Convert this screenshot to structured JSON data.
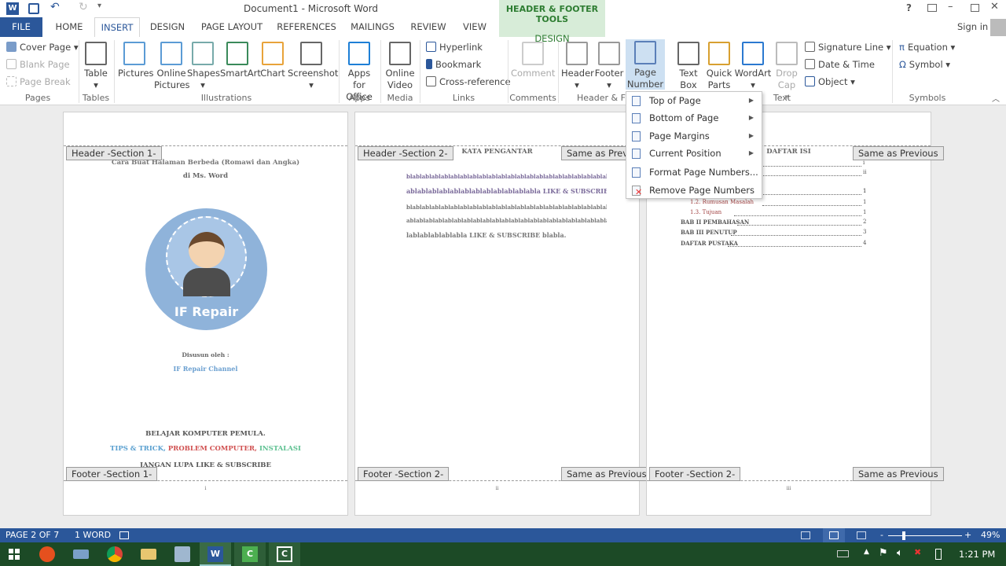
{
  "title": "Document1 - Microsoft Word",
  "contextual": {
    "group": "HEADER & FOOTER TOOLS",
    "tab": "DESIGN",
    "color": "#d7ecd8"
  },
  "window_controls": {
    "help": "?",
    "sign_in": "Sign in"
  },
  "tabs": [
    "FILE",
    "HOME",
    "INSERT",
    "DESIGN",
    "PAGE LAYOUT",
    "REFERENCES",
    "MAILINGS",
    "REVIEW",
    "VIEW"
  ],
  "active_tab": "INSERT",
  "ribbon": {
    "pages": {
      "items": [
        "Cover Page",
        "Blank Page",
        "Page Break"
      ],
      "label": "Pages"
    },
    "tables": {
      "items": [
        "Table"
      ],
      "label": "Tables"
    },
    "illustrations": {
      "items": [
        "Pictures",
        "Online Pictures",
        "Shapes",
        "SmartArt",
        "Chart",
        "Screenshot"
      ],
      "label": "Illustrations"
    },
    "apps": {
      "items": [
        "Apps for Office"
      ],
      "label": "Apps"
    },
    "media": {
      "items": [
        "Online Video"
      ],
      "label": "Media"
    },
    "links": {
      "items": [
        "Hyperlink",
        "Bookmark",
        "Cross-reference"
      ],
      "label": "Links"
    },
    "comments": {
      "items": [
        "Comment"
      ],
      "label": "Comments"
    },
    "headerfooter": {
      "items": [
        "Header",
        "Footer",
        "Page Number"
      ],
      "label": "Header & F"
    },
    "text": {
      "items": [
        "Text Box",
        "Quick Parts",
        "WordArt",
        "Drop Cap"
      ],
      "small": [
        "Signature Line",
        "Date & Time",
        "Object"
      ],
      "label": "Text"
    },
    "symbols": {
      "items": [
        "Equation",
        "Symbol"
      ],
      "label": "Symbols"
    }
  },
  "menu": {
    "items": [
      {
        "label": "Top of Page",
        "submenu": true
      },
      {
        "label": "Bottom of Page",
        "submenu": true
      },
      {
        "label": "Page Margins",
        "submenu": true
      },
      {
        "label": "Current Position",
        "submenu": true
      },
      {
        "label": "Format Page Numbers...",
        "submenu": false
      },
      {
        "label": "Remove Page Numbers",
        "submenu": false
      }
    ]
  },
  "pages": [
    {
      "header": "Header -Section 1-",
      "footer": "Footer -Section 1-",
      "title1": "Cara Buat Halaman Berbeda (Romawi dan Angka)",
      "title2": "di Ms. Word",
      "logo": "IF Repair",
      "by": "Disusun oleh :",
      "author": "IF Repair Channel",
      "line1": "BELAJAR KOMPUTER PEMULA.",
      "tips": [
        "TIPS & TRICK,",
        "PROBLEM COMPUTER,",
        "INSTALASI"
      ],
      "line3": "JANGAN LUPA LIKE & SUBSCRIBE",
      "page_no": "i"
    },
    {
      "header": "Header -Section 2-",
      "same": "Same as Previous",
      "footer": "Footer -Section 2-",
      "heading": "KATA PENGANTAR",
      "lines": [
        "blablablablablablablablablablablablablablablablablablablablablablablablablablabl",
        "ablablablablablablablablablablablabla LIKE & SUBSCRIBE",
        "blablablablablablablablablablablablablablablablablablablablablablablablablablabl",
        "ablablablablablablablablablablablablablablablablablablablablablablablablablablab",
        "lablablablablabla LIKE & SUBSCRIBE blabla."
      ],
      "page_no": "ii"
    },
    {
      "header": "Header -Section 2-",
      "same": "Same as Previous",
      "footer": "Footer -Section 2-",
      "heading": "DAFTAR ISI",
      "toc": [
        {
          "label": "",
          "page": "i"
        },
        {
          "label": "",
          "page": "ii"
        },
        {
          "label": "",
          "page": "1"
        },
        {
          "label": "",
          "page": "1"
        },
        {
          "label": "1.2.   Rumusan Masalah",
          "page": "1"
        },
        {
          "label": "1.3.   Tujuan",
          "page": "1"
        },
        {
          "label": "BAB II PEMBAHASAN",
          "page": "2"
        },
        {
          "label": "BAB III PENUTUP",
          "page": "3"
        },
        {
          "label": "DAFTAR PUSTAKA",
          "page": "4"
        }
      ],
      "page_no": "iii"
    }
  ],
  "status": {
    "page": "PAGE 2 OF 7",
    "words": "1 WORD",
    "zoom": "49%",
    "zoom_minus": "-",
    "zoom_plus": "+"
  },
  "clock": "1:21 PM"
}
